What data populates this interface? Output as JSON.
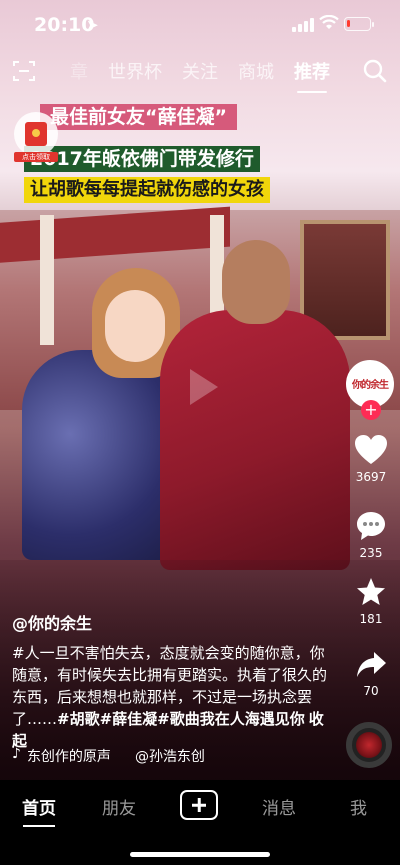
{
  "status_bar": {
    "time": "20:10",
    "location_icon": "location-arrow-icon",
    "battery_color": "#ff3b30",
    "battery_level": 0.15
  },
  "top_nav": {
    "tabs": [
      {
        "label": "章",
        "state": "faded"
      },
      {
        "label": "世界杯",
        "state": "normal"
      },
      {
        "label": "关注",
        "state": "normal"
      },
      {
        "label": "商城",
        "state": "normal"
      },
      {
        "label": "推荐",
        "state": "active"
      }
    ],
    "left_icon": "scan-icon",
    "right_icon": "search-icon"
  },
  "video": {
    "captions": [
      "最佳前女友“薛佳凝”",
      "2017年皈依佛门带发修行",
      "让胡歌每每提起就伤感的女孩"
    ],
    "red_packet_label": "点击领取",
    "avatar_text": "你的余生"
  },
  "rail": {
    "likes": "3697",
    "comments": "235",
    "favorites": "181",
    "shares": "70",
    "like_color": "#ffffff",
    "follow_color": "#fe2c55"
  },
  "info": {
    "author": "@你的余生",
    "description_plain": "#人一旦不害怕失去，态度就会变的随你意，你随意，有时候失去比拥有更踏实。执着了很久的东西，后来想想也就那样，不过是一场执念罢了……",
    "tags": [
      "#胡歌",
      "#薛佳凝",
      "#歌曲我在人海遇见你"
    ],
    "collapse": "收起",
    "music_text": "东创作的原声",
    "music_author": "@孙浩东创"
  },
  "tab_bar": {
    "tabs": [
      {
        "label": "首页",
        "active": true
      },
      {
        "label": "朋友",
        "active": false
      },
      {
        "label": "消息",
        "active": false
      },
      {
        "label": "我",
        "active": false
      }
    ]
  }
}
